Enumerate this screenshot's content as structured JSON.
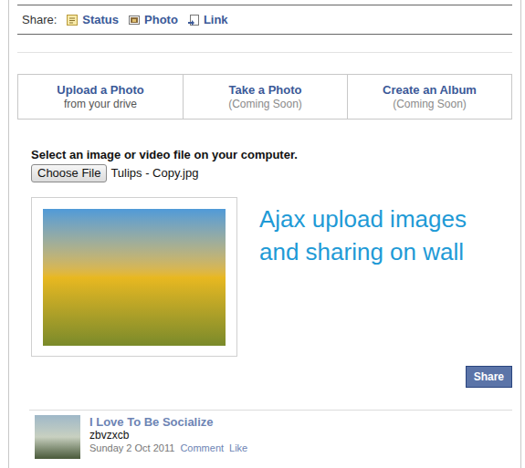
{
  "share_bar": {
    "label": "Share:",
    "items": [
      {
        "label": "Status"
      },
      {
        "label": "Photo"
      },
      {
        "label": "Link"
      }
    ]
  },
  "tabs": [
    {
      "title": "Upload a Photo",
      "subtitle": "from your drive",
      "selected": true
    },
    {
      "title": "Take a Photo",
      "subtitle": "(Coming Soon)",
      "selected": false
    },
    {
      "title": "Create an Album",
      "subtitle": "(Coming Soon)",
      "selected": false
    }
  ],
  "upload": {
    "prompt": "Select an image or video file on your computer.",
    "button": "Choose File",
    "filename": "Tulips - Copy.jpg"
  },
  "caption": "Ajax upload images and sharing on wall",
  "share_button": "Share",
  "posts": [
    {
      "author": "I Love To Be Socialize",
      "text": "zbvzxcb",
      "date": "Sunday 2 Oct 2011",
      "actions": [
        "Comment",
        "Like"
      ]
    }
  ]
}
